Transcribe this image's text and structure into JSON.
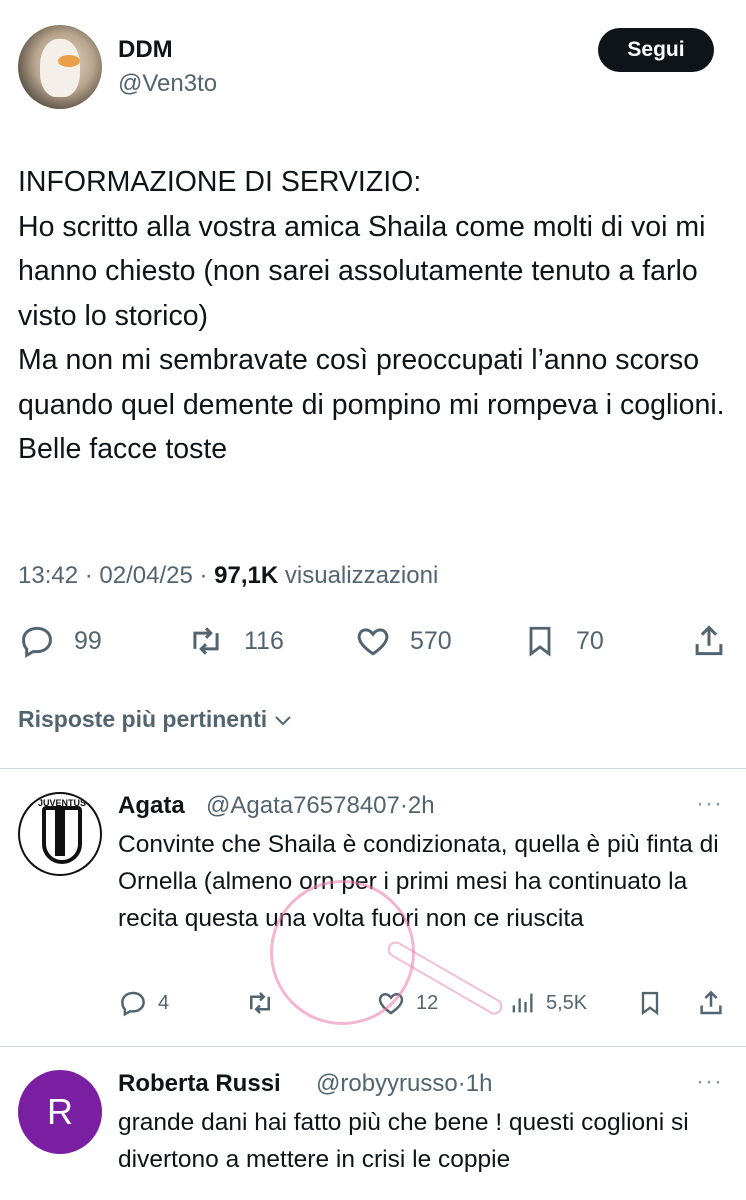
{
  "post": {
    "author_name": "DDM",
    "author_handle": "@Ven3to",
    "follow_label": "Segui",
    "text": "INFORMAZIONE DI SERVIZIO:\nHo scritto alla vostra amica Shaila come molti di voi mi hanno chiesto (non sarei assolutamente tenuto a farlo visto lo storico)\nMa non mi sembravate così preoccupati l’anno scorso quando quel demente di pompino mi rompeva i coglioni.\nBelle facce toste",
    "time": "13:42",
    "date": "02/04/25",
    "views_count": "97,1K",
    "views_label": "visualizzazioni",
    "stats": {
      "replies": "99",
      "reposts": "116",
      "likes": "570",
      "bookmarks": "70"
    }
  },
  "sort_label": "Risposte più pertinenti",
  "replies": [
    {
      "name": "Agata",
      "handle": "@Agata76578407",
      "time": "2h",
      "text": "Convinte che Shaila è condizionata, quella è più finta di Ornella (almeno orn per i primi mesi ha continuato la recita questa una volta fuori non ce riuscita",
      "stats": {
        "replies": "4",
        "likes": "12",
        "views": "5,5K"
      },
      "avatar_text": "JUVENTUS"
    },
    {
      "name": "Roberta Russi",
      "handle": "@robyyrusso",
      "time": "1h",
      "text": "grande dani hai fatto più che bene ! questi coglioni si divertono a mettere in crisi le coppie",
      "avatar_letter": "R",
      "avatar_color": "#7b1fa2"
    }
  ],
  "more_glyph": "···",
  "dot": "·",
  "icons": [
    "reply-icon",
    "repost-icon",
    "like-icon",
    "bookmark-icon",
    "share-icon",
    "views-icon",
    "chevron-down-icon"
  ],
  "colors": {
    "text": "#0f1419",
    "secondary": "#536471",
    "divider": "#cfd9de"
  }
}
